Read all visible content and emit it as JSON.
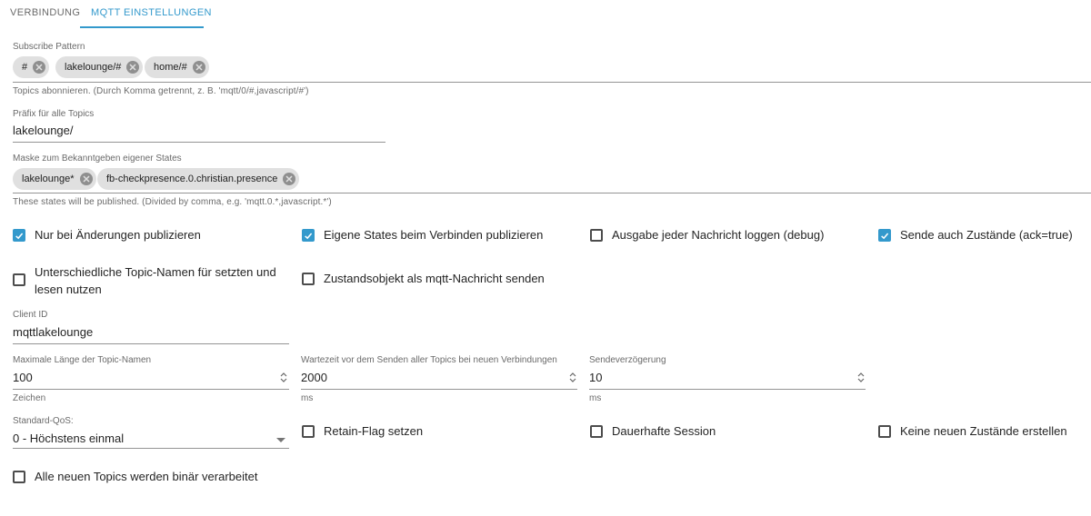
{
  "tabs": [
    {
      "label": "VERBINDUNG",
      "active": false
    },
    {
      "label": "MQTT EINSTELLUNGEN",
      "active": true
    }
  ],
  "colors": {
    "accent": "#3399cc",
    "chip_bg": "#e0e0e0"
  },
  "subscribe": {
    "label": "Subscribe Pattern",
    "chips": [
      "#",
      "lakelounge/#",
      "home/#"
    ],
    "helper": "Topics abonnieren. (Durch Komma getrennt, z. B. 'mqtt/0/#,javascript/#')"
  },
  "prefix": {
    "label": "Präfix für alle Topics",
    "value": "lakelounge/"
  },
  "mask": {
    "label": "Maske zum Bekanntgeben eigener States",
    "chips": [
      "lakelounge*",
      "fb-checkpresence.0.christian.presence"
    ],
    "helper": "These states will be published. (Divided by comma, e.g. 'mqtt.0.*,javascript.*')"
  },
  "checkboxes": {
    "only_changes": {
      "label": "Nur bei Änderungen publizieren",
      "checked": true
    },
    "publish_own_states": {
      "label": "Eigene States beim Verbinden publizieren",
      "checked": true
    },
    "log_debug": {
      "label": "Ausgabe jeder Nachricht loggen (debug)",
      "checked": false
    },
    "send_ack": {
      "label": "Sende auch Zustände (ack=true)",
      "checked": true
    },
    "different_topics_line1": "Unterschiedliche Topic-Namen für setzten und",
    "different_topics_line2": "lesen nutzen",
    "different_topics_checked": false,
    "state_object": {
      "label": "Zustandsobjekt als mqtt-Nachricht senden",
      "checked": false
    },
    "retain": {
      "label": "Retain-Flag setzen",
      "checked": false
    },
    "persistent": {
      "label": "Dauerhafte Session",
      "checked": false
    },
    "no_new_states": {
      "label": "Keine neuen Zustände erstellen",
      "checked": false
    },
    "binary": {
      "label": "Alle neuen Topics werden binär verarbeitet",
      "checked": false
    }
  },
  "client_id": {
    "label": "Client ID",
    "value": "mqttlakelounge"
  },
  "max_length": {
    "label": "Maximale Länge der Topic-Namen",
    "value": "100",
    "helper": "Zeichen"
  },
  "wait_time": {
    "label": "Wartezeit vor dem Senden aller Topics bei neuen Verbindungen",
    "value": "2000",
    "helper": "ms"
  },
  "send_delay": {
    "label": "Sendeverzögerung",
    "value": "10",
    "helper": "ms"
  },
  "qos": {
    "label": "Standard-QoS:",
    "value": "0 - Höchstens einmal"
  },
  "icons": {
    "chip_delete": "cancel-circle-icon",
    "checkmark": "check-icon",
    "spinner": "up-down-arrows-icon",
    "dropdown": "triangle-down-icon"
  }
}
